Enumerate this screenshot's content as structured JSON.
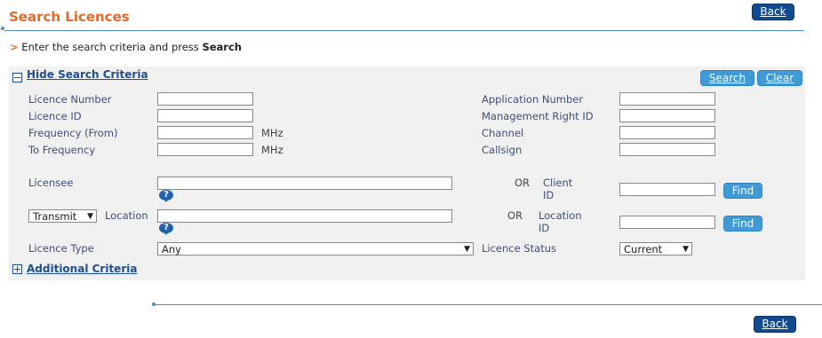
{
  "header": {
    "title": "Search Licences",
    "back_label": "Back",
    "instruction_prefix": "Enter the search criteria and press ",
    "instruction_bold": "Search"
  },
  "panel": {
    "hide_criteria_label": "Hide Search Criteria",
    "search_label": "Search",
    "clear_label": "Clear",
    "additional_criteria_label": "Additional Criteria"
  },
  "fields": {
    "licence_number": {
      "label": "Licence Number",
      "value": ""
    },
    "licence_id": {
      "label": "Licence ID",
      "value": ""
    },
    "frequency_from": {
      "label": "Frequency (From)",
      "value": "",
      "unit": "MHz"
    },
    "to_frequency": {
      "label": "To Frequency",
      "value": "",
      "unit": "MHz"
    },
    "application_number": {
      "label": "Application Number",
      "value": ""
    },
    "management_right_id": {
      "label": "Management Right ID",
      "value": ""
    },
    "channel": {
      "label": "Channel",
      "value": ""
    },
    "callsign": {
      "label": "Callsign",
      "value": ""
    },
    "licensee": {
      "label": "Licensee",
      "value": ""
    },
    "client_id": {
      "or_label": "OR",
      "label_line1": "Client",
      "label_line2": "ID",
      "value": "",
      "find_label": "Find"
    },
    "location": {
      "mode_value": "Transmit",
      "label": "Location",
      "value": ""
    },
    "location_id": {
      "or_label": "OR",
      "label_line1": "Location",
      "label_line2": "ID",
      "value": "",
      "find_label": "Find"
    },
    "licence_type": {
      "label": "Licence Type",
      "value": "Any"
    },
    "licence_status": {
      "label": "Licence Status",
      "value": "Current"
    }
  },
  "icons": {
    "help": "?",
    "dropdown_arrow": "▼",
    "chevron": ">"
  },
  "footer": {
    "back_label": "Back"
  }
}
